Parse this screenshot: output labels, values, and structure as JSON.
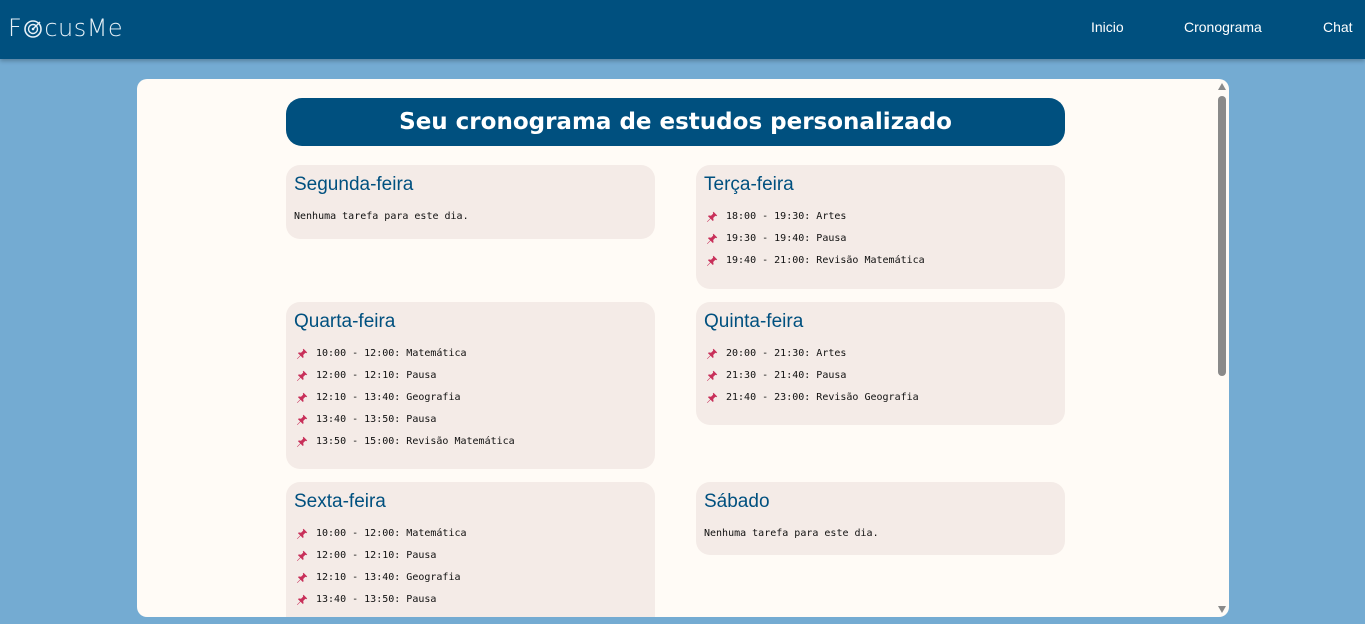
{
  "nav": {
    "logo_prefix": "F",
    "logo_suffix": "cusMe",
    "links": [
      "Inicio",
      "Cronograma",
      "Chat"
    ]
  },
  "page": {
    "title": "Seu cronograma de estudos personalizado"
  },
  "schedule": [
    {
      "day": "Segunda-feira",
      "empty_text": "Nenhuma tarefa para este dia.",
      "tasks": []
    },
    {
      "day": "Terça-feira",
      "tasks": [
        "18:00 - 19:30: Artes",
        "19:30 - 19:40: Pausa",
        "19:40 - 21:00: Revisão Matemática"
      ]
    },
    {
      "day": "Quarta-feira",
      "tasks": [
        "10:00 - 12:00: Matemática",
        "12:00 - 12:10: Pausa",
        "12:10 - 13:40: Geografia",
        "13:40 - 13:50: Pausa",
        "13:50 - 15:00: Revisão Matemática"
      ]
    },
    {
      "day": "Quinta-feira",
      "tasks": [
        "20:00 - 21:30: Artes",
        "21:30 - 21:40: Pausa",
        "21:40 - 23:00: Revisão Geografia"
      ]
    },
    {
      "day": "Sexta-feira",
      "tasks": [
        "10:00 - 12:00: Matemática",
        "12:00 - 12:10: Pausa",
        "12:10 - 13:40: Geografia",
        "13:40 - 13:50: Pausa"
      ]
    },
    {
      "day": "Sábado",
      "empty_text": "Nenhuma tarefa para este dia.",
      "tasks": []
    }
  ],
  "icons": {
    "task_bullet": "pushpin-icon",
    "logo_o": "target-icon"
  },
  "colors": {
    "brand": "#00507f",
    "background": "#74abd2",
    "card": "#f4ebe7",
    "panel": "#fffbf6",
    "pin": "#c8305a"
  }
}
